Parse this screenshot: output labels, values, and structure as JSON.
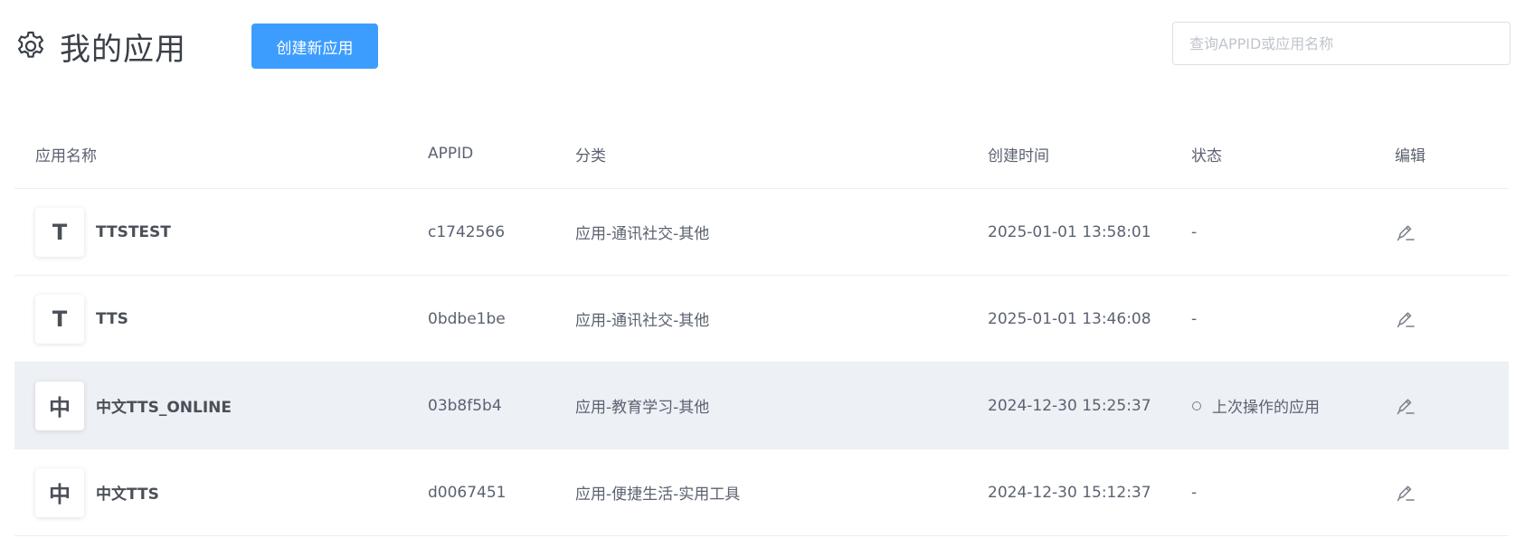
{
  "header": {
    "title": "我的应用",
    "create_button": "创建新应用",
    "search_placeholder": "查询APPID或应用名称"
  },
  "table": {
    "columns": [
      "应用名称",
      "APPID",
      "分类",
      "创建时间",
      "状态",
      "编辑"
    ],
    "rows": [
      {
        "avatar": "T",
        "name": "TTSTEST",
        "appid": "c1742566",
        "category": "应用-通讯社交-其他",
        "created": "2025-01-01 13:58:01",
        "status": "-"
      },
      {
        "avatar": "T",
        "name": "TTS",
        "appid": "0bdbe1be",
        "category": "应用-通讯社交-其他",
        "created": "2025-01-01 13:46:08",
        "status": "-"
      },
      {
        "avatar": "中",
        "name": "中文TTS_ONLINE",
        "appid": "03b8f5b4",
        "category": "应用-教育学习-其他",
        "created": "2024-12-30 15:25:37",
        "status": "上次操作的应用"
      },
      {
        "avatar": "中",
        "name": "中文TTS",
        "appid": "d0067451",
        "category": "应用-便捷生活-实用工具",
        "created": "2024-12-30 15:12:37",
        "status": "-"
      }
    ]
  },
  "icons": {
    "title": "gear-icon",
    "edit": "pencil-icon",
    "status": "circle-icon"
  },
  "colors": {
    "primary_button": "#3d9dff",
    "highlight_row": "#edf0f5"
  }
}
